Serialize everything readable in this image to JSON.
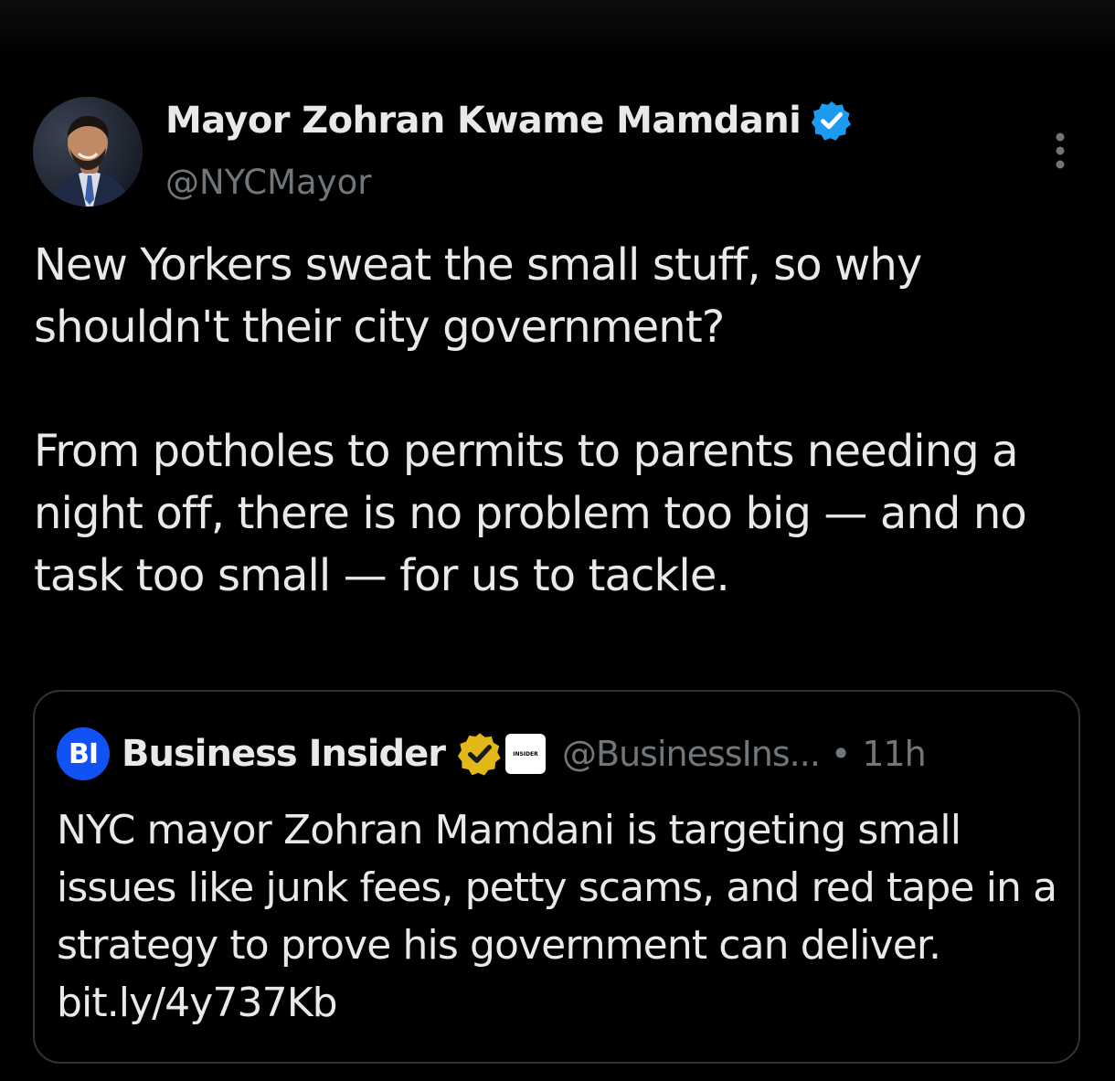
{
  "tweet": {
    "author": {
      "name": "Mayor Zohran Kwame Mamdani",
      "handle": "@NYCMayor",
      "verified_color": "#1d9bf0"
    },
    "text": "New Yorkers sweat the small stuff, so why shouldn't their city government?\n\nFrom potholes to permits to parents needing a night off, there is no problem too big — and no task too small — for us to tackle.",
    "more_icon": "more-vertical-icon"
  },
  "quote": {
    "logo_text": "BI",
    "logo_color": "#1152f5",
    "name": "Business Insider",
    "badge_color": "#e2b719",
    "affiliate_label": "INSIDER",
    "handle": "@BusinessIns...",
    "separator": "•",
    "time": "11h",
    "text": "NYC mayor Zohran Mamdani is targeting small issues like junk fees, petty scams, and red tape in a strategy to prove his government can deliver. bit.ly/4y737Kb"
  },
  "colors": {
    "background": "#000000",
    "text_primary": "#e7e9ea",
    "text_secondary": "#71767b",
    "border": "#2f3336"
  }
}
